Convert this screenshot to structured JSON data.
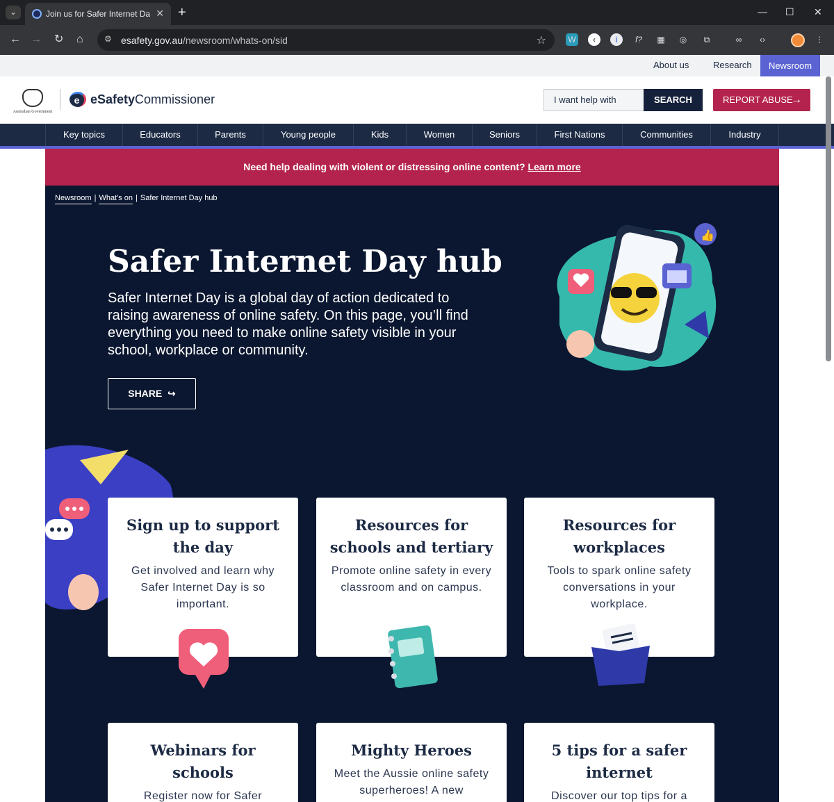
{
  "browser": {
    "tab_title": "Join us for Safer Internet Day | e",
    "url_domain": "esafety.gov.au",
    "url_path": "/newsroom/whats-on/sid"
  },
  "utility": {
    "about": "About us",
    "research": "Research",
    "newsroom": "Newsroom"
  },
  "header": {
    "gov_label": "Australian Government",
    "logo_bold": "eSafety",
    "logo_rest": "Commissioner",
    "search_placeholder": "I want help with",
    "search_button": "SEARCH",
    "report_button": "REPORT ABUSE"
  },
  "nav": [
    "Key topics",
    "Educators",
    "Parents",
    "Young people",
    "Kids",
    "Women",
    "Seniors",
    "First Nations",
    "Communities",
    "Industry"
  ],
  "alert": {
    "text": "Need help dealing with violent or distressing online content?",
    "link": "Learn more"
  },
  "breadcrumb": {
    "items": [
      "Newsroom",
      "What's on"
    ],
    "current": "Safer Internet Day hub"
  },
  "hero": {
    "title": "Safer Internet Day hub",
    "description": "Safer Internet Day is a global day of action dedicated to raising awareness of online safety. On this page, you’ll find everything you need to make online safety visible in your school, workplace or community.",
    "share": "SHARE"
  },
  "cards": [
    {
      "title": "Sign up to support the day",
      "text": "Get involved and learn why Safer Internet Day is so important.",
      "icon": "heart-bubble-icon"
    },
    {
      "title": "Resources for schools and tertiary",
      "text": "Promote online safety in every classroom and on campus.",
      "icon": "notebook-icon"
    },
    {
      "title": "Resources for workplaces",
      "text": "Tools to spark online safety conversations in your workplace.",
      "icon": "folder-icon"
    },
    {
      "title": "Webinars for schools",
      "text": "Register now for Safer",
      "icon": ""
    },
    {
      "title": "Mighty Heroes",
      "text": "Meet the Aussie online safety superheroes! A new",
      "icon": ""
    },
    {
      "title": "5 tips for a safer internet",
      "text": "Discover our top tips for a",
      "icon": ""
    }
  ],
  "colors": {
    "navy": "#1c2a44",
    "hero_bg": "#0b1730",
    "accent_red": "#b4234d",
    "accent_purple": "#5b63d3"
  }
}
